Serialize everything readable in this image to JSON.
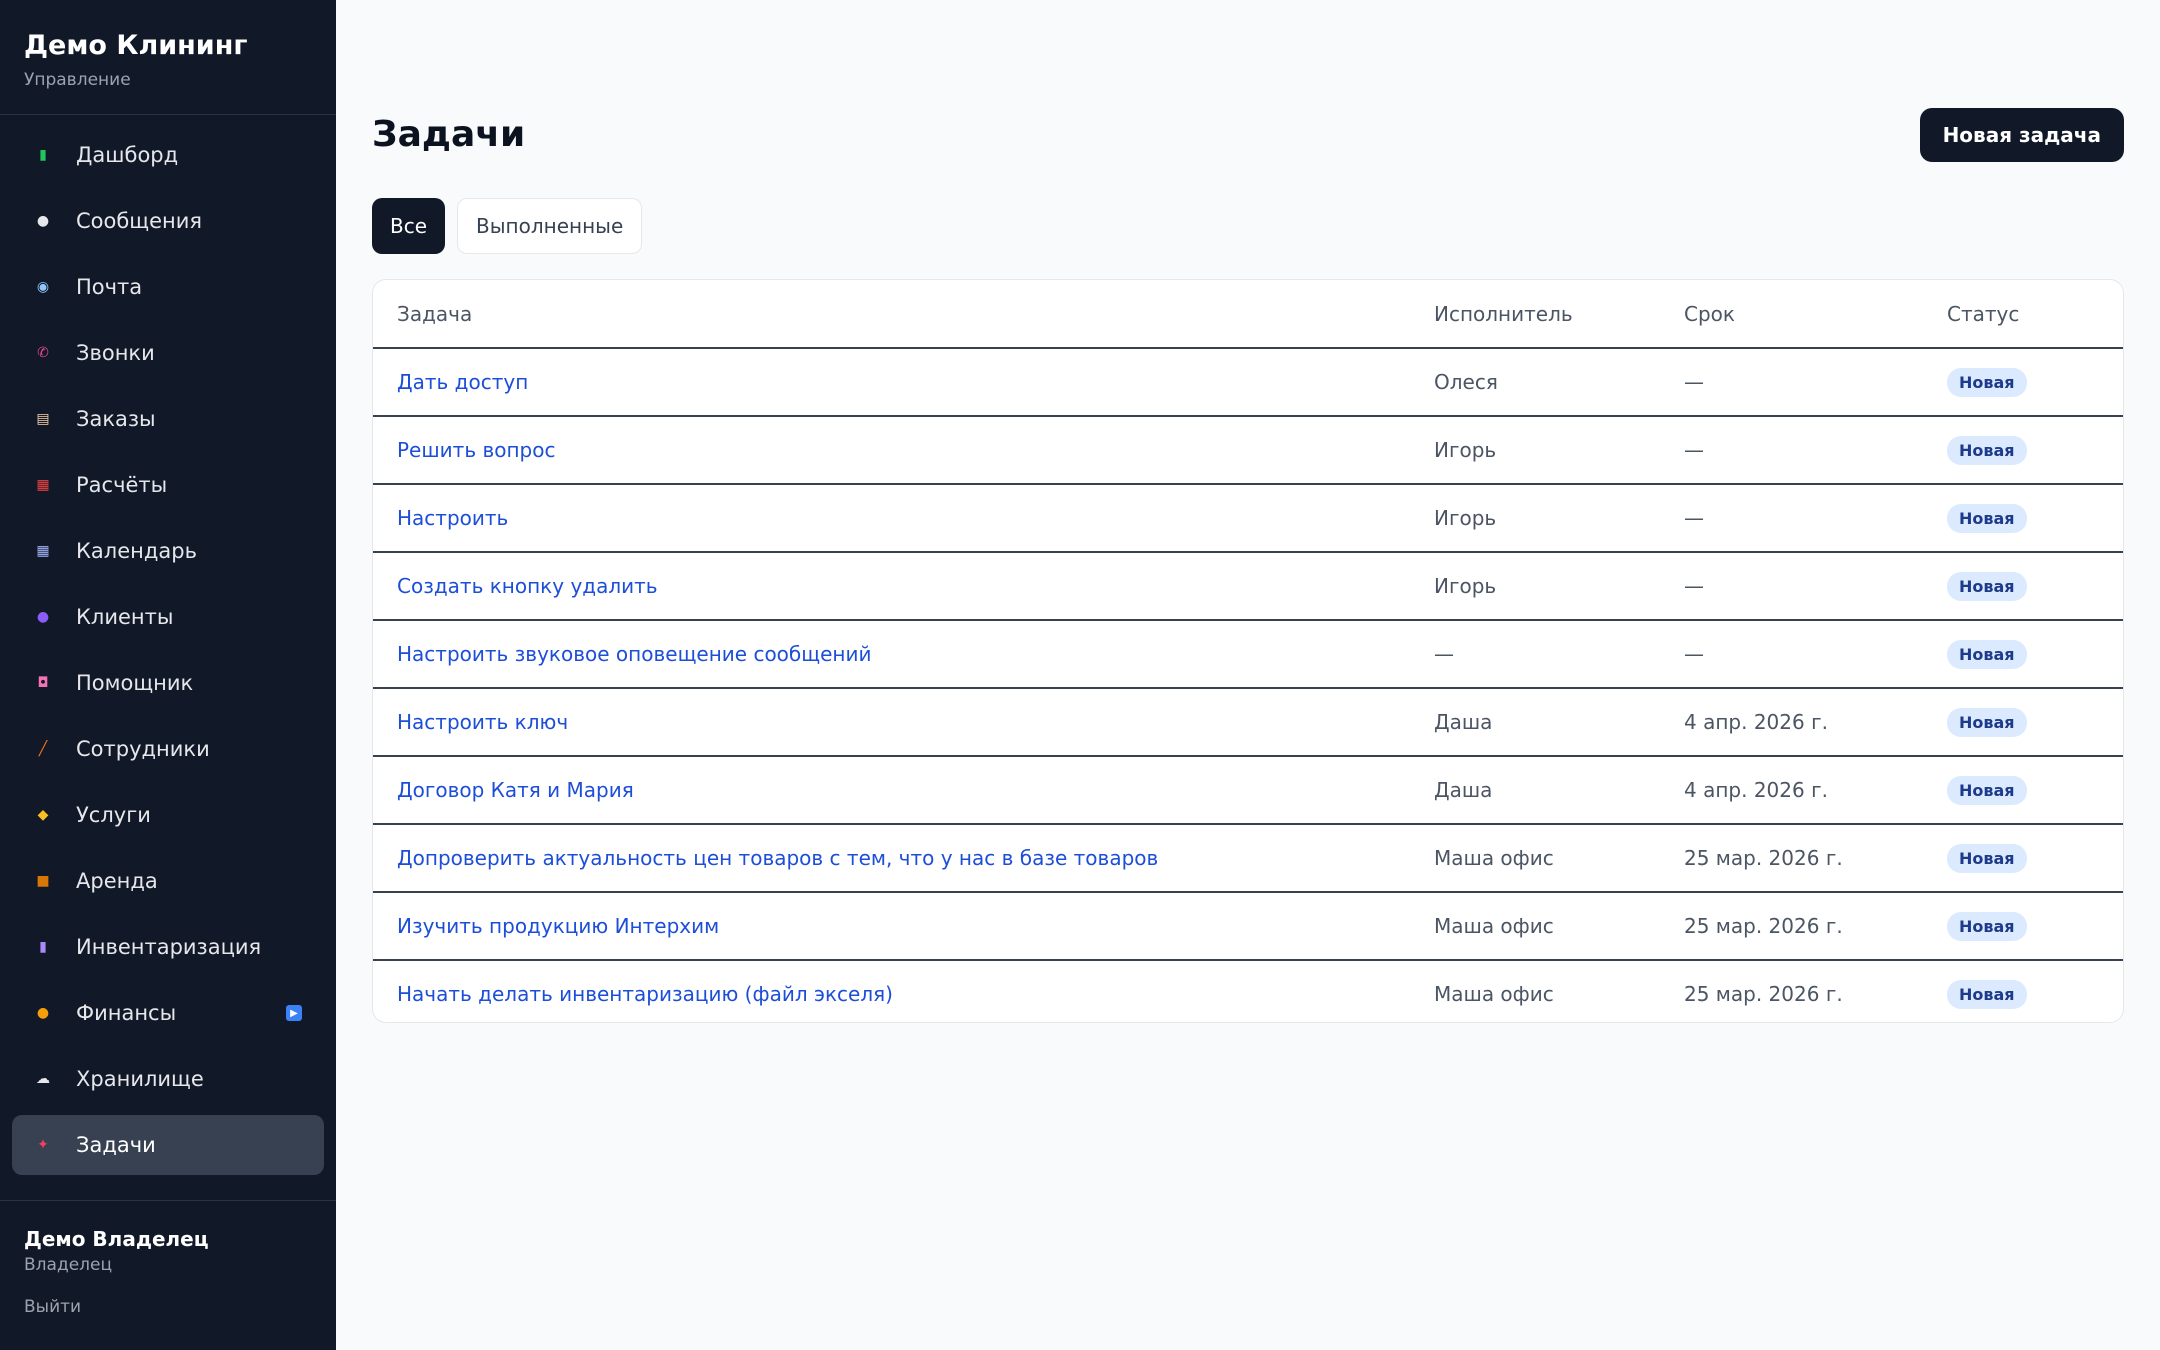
{
  "sidebar": {
    "brand_title": "Демо Клининг",
    "brand_subtitle": "Управление",
    "items": [
      {
        "label": "Дашборд",
        "icon": "bar-chart-icon",
        "color": "#22c55e"
      },
      {
        "label": "Сообщения",
        "icon": "speech-bubble-icon",
        "color": "#e5e7eb"
      },
      {
        "label": "Почта",
        "icon": "mail-icon",
        "color": "#93c5fd"
      },
      {
        "label": "Звонки",
        "icon": "phone-icon",
        "color": "#ec4899"
      },
      {
        "label": "Заказы",
        "icon": "clipboard-icon",
        "color": "#f5d0a9"
      },
      {
        "label": "Расчёты",
        "icon": "abacus-icon",
        "color": "#ef4444"
      },
      {
        "label": "Календарь",
        "icon": "calendar-icon",
        "color": "#a5b4fc"
      },
      {
        "label": "Клиенты",
        "icon": "people-icon",
        "color": "#8b5cf6"
      },
      {
        "label": "Помощник",
        "icon": "robot-icon",
        "color": "#f472b6"
      },
      {
        "label": "Сотрудники",
        "icon": "broom-icon",
        "color": "#f97316"
      },
      {
        "label": "Услуги",
        "icon": "tag-icon",
        "color": "#fbbf24"
      },
      {
        "label": "Аренда",
        "icon": "box-icon",
        "color": "#d97706"
      },
      {
        "label": "Инвентаризация",
        "icon": "inventory-icon",
        "color": "#a78bfa"
      },
      {
        "label": "Финансы",
        "icon": "money-bag-icon",
        "color": "#f59e0b"
      },
      {
        "label": "Хранилище",
        "icon": "cloud-icon",
        "color": "#e5e7eb"
      },
      {
        "label": "Задачи",
        "icon": "pushpin-icon",
        "color": "#f43f5e"
      }
    ],
    "active_index": 15,
    "finance_badge_icon": "play-icon",
    "user_name": "Демо Владелец",
    "user_role": "Владелец",
    "logout_label": "Выйти"
  },
  "main": {
    "title": "Задачи",
    "new_task_label": "Новая задача",
    "tabs": [
      {
        "label": "Все",
        "active": true
      },
      {
        "label": "Выполненные",
        "active": false
      }
    ],
    "table": {
      "headers": [
        "Задача",
        "Исполнитель",
        "Срок",
        "Статус"
      ],
      "rows": [
        {
          "task": "Дать доступ",
          "assignee": "Олеся",
          "due": "—",
          "status": "Новая"
        },
        {
          "task": "Решить вопрос",
          "assignee": "Игорь",
          "due": "—",
          "status": "Новая"
        },
        {
          "task": "Настроить",
          "assignee": "Игорь",
          "due": "—",
          "status": "Новая"
        },
        {
          "task": "Создать кнопку удалить",
          "assignee": "Игорь",
          "due": "—",
          "status": "Новая"
        },
        {
          "task": "Настроить звуковое оповещение сообщений",
          "assignee": "—",
          "due": "—",
          "status": "Новая"
        },
        {
          "task": "Настроить ключ",
          "assignee": "Даша",
          "due": "4 апр. 2026 г.",
          "status": "Новая"
        },
        {
          "task": "Договор Катя и Мария",
          "assignee": "Даша",
          "due": "4 апр. 2026 г.",
          "status": "Новая"
        },
        {
          "task": "Допроверить актуальность цен товаров с тем, что у нас в базе товаров",
          "assignee": "Маша офис",
          "due": "25 мар. 2026 г.",
          "status": "Новая"
        },
        {
          "task": "Изучить продукцию Интерхим",
          "assignee": "Маша офис",
          "due": "25 мар. 2026 г.",
          "status": "Новая"
        },
        {
          "task": "Начать делать инвентаризацию (файл экселя)",
          "assignee": "Маша офис",
          "due": "25 мар. 2026 г.",
          "status": "Новая"
        }
      ]
    }
  }
}
